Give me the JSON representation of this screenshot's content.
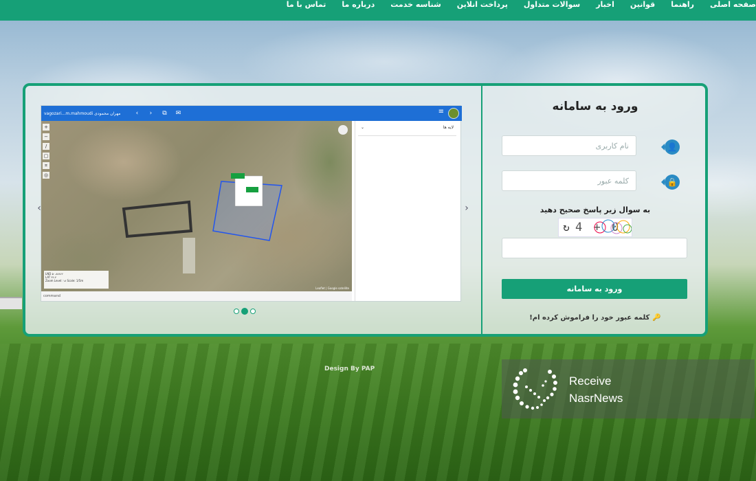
{
  "nav": {
    "items": [
      "صفحه اصلی",
      "راهنما",
      "قوانین",
      "اخبار",
      "سوالات متداول",
      "پرداخت انلاین",
      "شناسه خدمت",
      "درباره ما",
      "تماس با ما"
    ]
  },
  "login": {
    "title": "ورود به سامانه",
    "username_placeholder": "نام کاربری",
    "password_placeholder": "کلمه عبور",
    "captcha_label": "به سوال زیر پاسخ صحیح دهید",
    "captcha_text": "4 + 0",
    "captcha_value": "",
    "submit_label": "ورود به سامانه",
    "forgot_label": "کلمه عبور خود را فراموش کرده ام!"
  },
  "preview": {
    "user_text": "vagozari...m.mahmoudi  مهران محمودی",
    "layers_label": "لایه ها",
    "command_label": "command",
    "status_line1": "LND  ۵۰.۸۸۸۶۶",
    "status_line2": "LAT ۳۶.۴",
    "status_line3": "Zoom Level: ۱۸  Scale: 1/5m",
    "attribution": "Leaflet | Google satellite"
  },
  "slider": {
    "dot_count": 3,
    "active_index": 1
  },
  "footer": {
    "design_by": "Design By PAP"
  },
  "badge": {
    "line1": "Receive",
    "line2": "NasrNews"
  },
  "colors": {
    "brand_green": "#16a077",
    "map_toolbar_blue": "#1e6fd6",
    "icon_blue": "#2a8bc4"
  }
}
